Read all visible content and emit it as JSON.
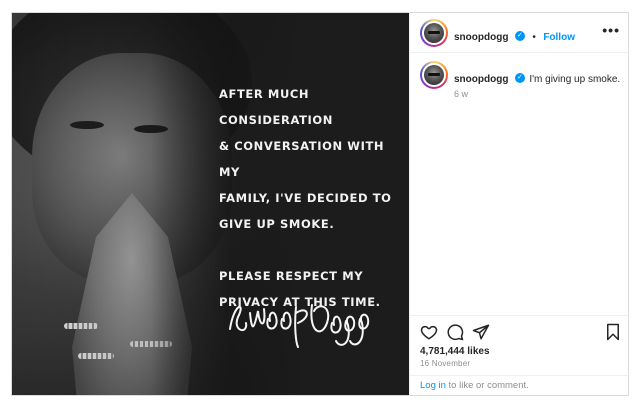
{
  "post": {
    "quote_lines_1": [
      "After much consideration",
      "& conversation with my",
      "family, I've decided to",
      "give up smoke."
    ],
    "quote_lines_2": [
      "Please respect my",
      "privacy at this time."
    ]
  },
  "header": {
    "username": "snoopdogg",
    "verified_mark": "✓",
    "separator": "•",
    "follow_label": "Follow",
    "more_label": "•••"
  },
  "caption": {
    "username": "snoopdogg",
    "verified_mark": "✓",
    "text": "I'm giving up smoke.",
    "time": "6 w"
  },
  "icons": {
    "like": "heart-icon",
    "comment": "comment-icon",
    "share": "share-icon",
    "save": "bookmark-icon"
  },
  "stats": {
    "likes": "4,781,444 likes",
    "date": "16 November"
  },
  "login": {
    "link": "Log in",
    "rest": " to like or comment."
  },
  "colors": {
    "accent": "#0095f6",
    "text": "#262626",
    "muted": "#8e8e8e",
    "border": "#dbdbdb"
  }
}
